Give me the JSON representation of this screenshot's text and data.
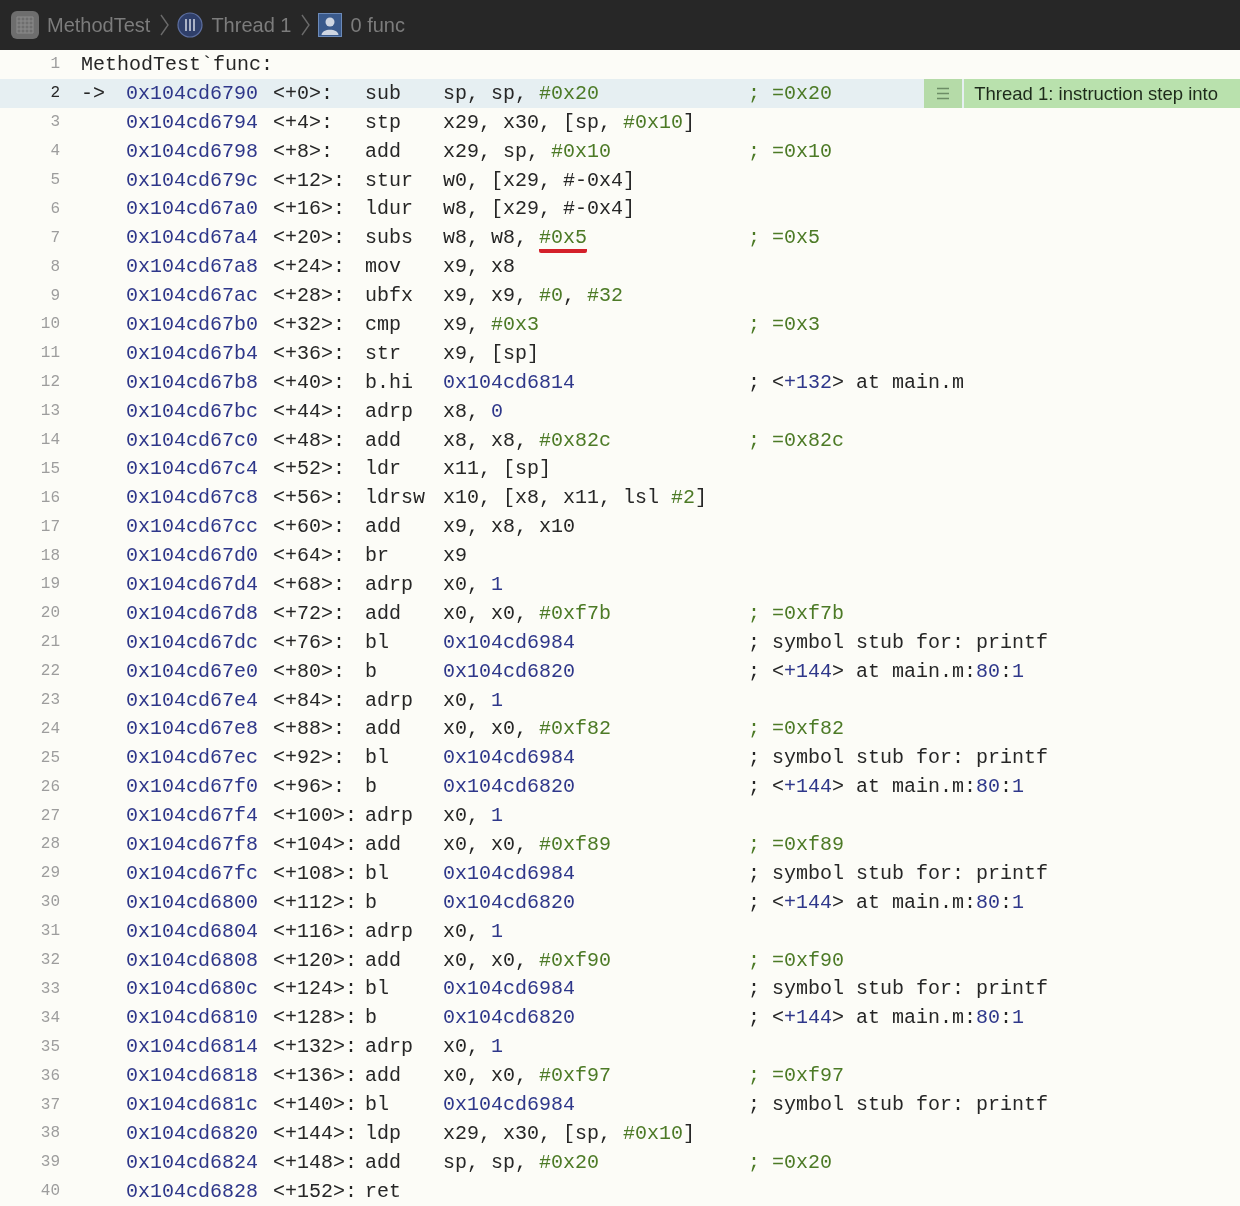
{
  "breadcrumbs": [
    {
      "kind": "app",
      "label": "MethodTest"
    },
    {
      "kind": "thread",
      "label": "Thread 1"
    },
    {
      "kind": "frame",
      "label": "0 func"
    }
  ],
  "lines": [
    {
      "number": "1",
      "kind": "label",
      "current": false,
      "label": "MethodTest`func:"
    },
    {
      "number": "2",
      "kind": "instruction",
      "current": true,
      "pointer": "->",
      "address": "0x104cd6790",
      "offset": "<+0>:",
      "mnemonic": "sub",
      "operands": [
        {
          "text": "sp, sp, ",
          "kind": "plain"
        },
        {
          "text": "#0x20",
          "kind": "imm"
        }
      ],
      "comment": [
        {
          "text": "; =0x20",
          "kind": "imm"
        }
      ],
      "annotation": "Thread 1: instruction step into"
    },
    {
      "number": "3",
      "kind": "instruction",
      "current": false,
      "address": "0x104cd6794",
      "offset": "<+4>:",
      "mnemonic": "stp",
      "operands": [
        {
          "text": "x29, x30, [sp, ",
          "kind": "plain"
        },
        {
          "text": "#0x10",
          "kind": "imm"
        },
        {
          "text": "]",
          "kind": "plain"
        }
      ]
    },
    {
      "number": "4",
      "kind": "instruction",
      "current": false,
      "address": "0x104cd6798",
      "offset": "<+8>:",
      "mnemonic": "add",
      "operands": [
        {
          "text": "x29, sp, ",
          "kind": "plain"
        },
        {
          "text": "#0x10",
          "kind": "imm"
        }
      ],
      "comment": [
        {
          "text": "; =0x10",
          "kind": "imm"
        }
      ]
    },
    {
      "number": "5",
      "kind": "instruction",
      "current": false,
      "address": "0x104cd679c",
      "offset": "<+12>:",
      "mnemonic": "stur",
      "operands": [
        {
          "text": "w0, [x29, #-0x4]",
          "kind": "plain"
        }
      ]
    },
    {
      "number": "6",
      "kind": "instruction",
      "current": false,
      "address": "0x104cd67a0",
      "offset": "<+16>:",
      "mnemonic": "ldur",
      "operands": [
        {
          "text": "w8, [x29, #-0x4]",
          "kind": "plain"
        }
      ]
    },
    {
      "number": "7",
      "kind": "instruction",
      "current": false,
      "address": "0x104cd67a4",
      "offset": "<+20>:",
      "mnemonic": "subs",
      "operands": [
        {
          "text": "w8, w8, ",
          "kind": "plain"
        },
        {
          "text": "#0x5",
          "kind": "imm",
          "underlined": true
        }
      ],
      "comment": [
        {
          "text": "; =0x5",
          "kind": "imm"
        }
      ]
    },
    {
      "number": "8",
      "kind": "instruction",
      "current": false,
      "address": "0x104cd67a8",
      "offset": "<+24>:",
      "mnemonic": "mov",
      "operands": [
        {
          "text": "x9, x8",
          "kind": "plain"
        }
      ]
    },
    {
      "number": "9",
      "kind": "instruction",
      "current": false,
      "address": "0x104cd67ac",
      "offset": "<+28>:",
      "mnemonic": "ubfx",
      "operands": [
        {
          "text": "x9, x9, ",
          "kind": "plain"
        },
        {
          "text": "#0",
          "kind": "imm"
        },
        {
          "text": ", ",
          "kind": "plain"
        },
        {
          "text": "#32",
          "kind": "imm"
        }
      ]
    },
    {
      "number": "10",
      "kind": "instruction",
      "current": false,
      "address": "0x104cd67b0",
      "offset": "<+32>:",
      "mnemonic": "cmp",
      "operands": [
        {
          "text": "x9, ",
          "kind": "plain"
        },
        {
          "text": "#0x3",
          "kind": "imm"
        }
      ],
      "comment": [
        {
          "text": "; =0x3",
          "kind": "imm"
        }
      ]
    },
    {
      "number": "11",
      "kind": "instruction",
      "current": false,
      "address": "0x104cd67b4",
      "offset": "<+36>:",
      "mnemonic": "str",
      "operands": [
        {
          "text": "x9, [sp]",
          "kind": "plain"
        }
      ]
    },
    {
      "number": "12",
      "kind": "instruction",
      "current": false,
      "address": "0x104cd67b8",
      "offset": "<+40>:",
      "mnemonic": "b.hi",
      "operands": [
        {
          "text": "0x104cd6814",
          "kind": "addr"
        }
      ],
      "comment": [
        {
          "text": "; <",
          "kind": "plain"
        },
        {
          "text": "+132",
          "kind": "addr"
        },
        {
          "text": "> at main.m",
          "kind": "plain"
        }
      ]
    },
    {
      "number": "13",
      "kind": "instruction",
      "current": false,
      "address": "0x104cd67bc",
      "offset": "<+44>:",
      "mnemonic": "adrp",
      "operands": [
        {
          "text": "x8, ",
          "kind": "plain"
        },
        {
          "text": "0",
          "kind": "addr"
        }
      ]
    },
    {
      "number": "14",
      "kind": "instruction",
      "current": false,
      "address": "0x104cd67c0",
      "offset": "<+48>:",
      "mnemonic": "add",
      "operands": [
        {
          "text": "x8, x8, ",
          "kind": "plain"
        },
        {
          "text": "#0x82c",
          "kind": "imm"
        }
      ],
      "comment": [
        {
          "text": "; =0x82c",
          "kind": "imm"
        }
      ]
    },
    {
      "number": "15",
      "kind": "instruction",
      "current": false,
      "address": "0x104cd67c4",
      "offset": "<+52>:",
      "mnemonic": "ldr",
      "operands": [
        {
          "text": "x11, [sp]",
          "kind": "plain"
        }
      ]
    },
    {
      "number": "16",
      "kind": "instruction",
      "current": false,
      "address": "0x104cd67c8",
      "offset": "<+56>:",
      "mnemonic": "ldrsw",
      "operands": [
        {
          "text": "x10, [x8, x11, lsl ",
          "kind": "plain"
        },
        {
          "text": "#2",
          "kind": "imm"
        },
        {
          "text": "]",
          "kind": "plain"
        }
      ]
    },
    {
      "number": "17",
      "kind": "instruction",
      "current": false,
      "address": "0x104cd67cc",
      "offset": "<+60>:",
      "mnemonic": "add",
      "operands": [
        {
          "text": "x9, x8, x10",
          "kind": "plain"
        }
      ]
    },
    {
      "number": "18",
      "kind": "instruction",
      "current": false,
      "address": "0x104cd67d0",
      "offset": "<+64>:",
      "mnemonic": "br",
      "operands": [
        {
          "text": "x9",
          "kind": "plain"
        }
      ]
    },
    {
      "number": "19",
      "kind": "instruction",
      "current": false,
      "address": "0x104cd67d4",
      "offset": "<+68>:",
      "mnemonic": "adrp",
      "operands": [
        {
          "text": "x0, ",
          "kind": "plain"
        },
        {
          "text": "1",
          "kind": "addr"
        }
      ]
    },
    {
      "number": "20",
      "kind": "instruction",
      "current": false,
      "address": "0x104cd67d8",
      "offset": "<+72>:",
      "mnemonic": "add",
      "operands": [
        {
          "text": "x0, x0, ",
          "kind": "plain"
        },
        {
          "text": "#0xf7b",
          "kind": "imm"
        }
      ],
      "comment": [
        {
          "text": "; =0xf7b",
          "kind": "imm"
        }
      ]
    },
    {
      "number": "21",
      "kind": "instruction",
      "current": false,
      "address": "0x104cd67dc",
      "offset": "<+76>:",
      "mnemonic": "bl",
      "operands": [
        {
          "text": "0x104cd6984",
          "kind": "addr"
        }
      ],
      "comment": [
        {
          "text": "; symbol stub for: printf",
          "kind": "plain"
        }
      ]
    },
    {
      "number": "22",
      "kind": "instruction",
      "current": false,
      "address": "0x104cd67e0",
      "offset": "<+80>:",
      "mnemonic": "b",
      "operands": [
        {
          "text": "0x104cd6820",
          "kind": "addr"
        }
      ],
      "comment": [
        {
          "text": "; <",
          "kind": "plain"
        },
        {
          "text": "+144",
          "kind": "addr"
        },
        {
          "text": "> at main.m:",
          "kind": "plain"
        },
        {
          "text": "80",
          "kind": "addr"
        },
        {
          "text": ":",
          "kind": "plain"
        },
        {
          "text": "1",
          "kind": "addr"
        }
      ]
    },
    {
      "number": "23",
      "kind": "instruction",
      "current": false,
      "address": "0x104cd67e4",
      "offset": "<+84>:",
      "mnemonic": "adrp",
      "operands": [
        {
          "text": "x0, ",
          "kind": "plain"
        },
        {
          "text": "1",
          "kind": "addr"
        }
      ]
    },
    {
      "number": "24",
      "kind": "instruction",
      "current": false,
      "address": "0x104cd67e8",
      "offset": "<+88>:",
      "mnemonic": "add",
      "operands": [
        {
          "text": "x0, x0, ",
          "kind": "plain"
        },
        {
          "text": "#0xf82",
          "kind": "imm"
        }
      ],
      "comment": [
        {
          "text": "; =0xf82",
          "kind": "imm"
        }
      ]
    },
    {
      "number": "25",
      "kind": "instruction",
      "current": false,
      "address": "0x104cd67ec",
      "offset": "<+92>:",
      "mnemonic": "bl",
      "operands": [
        {
          "text": "0x104cd6984",
          "kind": "addr"
        }
      ],
      "comment": [
        {
          "text": "; symbol stub for: printf",
          "kind": "plain"
        }
      ]
    },
    {
      "number": "26",
      "kind": "instruction",
      "current": false,
      "address": "0x104cd67f0",
      "offset": "<+96>:",
      "mnemonic": "b",
      "operands": [
        {
          "text": "0x104cd6820",
          "kind": "addr"
        }
      ],
      "comment": [
        {
          "text": "; <",
          "kind": "plain"
        },
        {
          "text": "+144",
          "kind": "addr"
        },
        {
          "text": "> at main.m:",
          "kind": "plain"
        },
        {
          "text": "80",
          "kind": "addr"
        },
        {
          "text": ":",
          "kind": "plain"
        },
        {
          "text": "1",
          "kind": "addr"
        }
      ]
    },
    {
      "number": "27",
      "kind": "instruction",
      "current": false,
      "address": "0x104cd67f4",
      "offset": "<+100>:",
      "mnemonic": "adrp",
      "operands": [
        {
          "text": "x0, ",
          "kind": "plain"
        },
        {
          "text": "1",
          "kind": "addr"
        }
      ]
    },
    {
      "number": "28",
      "kind": "instruction",
      "current": false,
      "address": "0x104cd67f8",
      "offset": "<+104>:",
      "mnemonic": "add",
      "operands": [
        {
          "text": "x0, x0, ",
          "kind": "plain"
        },
        {
          "text": "#0xf89",
          "kind": "imm"
        }
      ],
      "comment": [
        {
          "text": "; =0xf89",
          "kind": "imm"
        }
      ]
    },
    {
      "number": "29",
      "kind": "instruction",
      "current": false,
      "address": "0x104cd67fc",
      "offset": "<+108>:",
      "mnemonic": "bl",
      "operands": [
        {
          "text": "0x104cd6984",
          "kind": "addr"
        }
      ],
      "comment": [
        {
          "text": "; symbol stub for: printf",
          "kind": "plain"
        }
      ]
    },
    {
      "number": "30",
      "kind": "instruction",
      "current": false,
      "address": "0x104cd6800",
      "offset": "<+112>:",
      "mnemonic": "b",
      "operands": [
        {
          "text": "0x104cd6820",
          "kind": "addr"
        }
      ],
      "comment": [
        {
          "text": "; <",
          "kind": "plain"
        },
        {
          "text": "+144",
          "kind": "addr"
        },
        {
          "text": "> at main.m:",
          "kind": "plain"
        },
        {
          "text": "80",
          "kind": "addr"
        },
        {
          "text": ":",
          "kind": "plain"
        },
        {
          "text": "1",
          "kind": "addr"
        }
      ]
    },
    {
      "number": "31",
      "kind": "instruction",
      "current": false,
      "address": "0x104cd6804",
      "offset": "<+116>:",
      "mnemonic": "adrp",
      "operands": [
        {
          "text": "x0, ",
          "kind": "plain"
        },
        {
          "text": "1",
          "kind": "addr"
        }
      ]
    },
    {
      "number": "32",
      "kind": "instruction",
      "current": false,
      "address": "0x104cd6808",
      "offset": "<+120>:",
      "mnemonic": "add",
      "operands": [
        {
          "text": "x0, x0, ",
          "kind": "plain"
        },
        {
          "text": "#0xf90",
          "kind": "imm"
        }
      ],
      "comment": [
        {
          "text": "; =0xf90",
          "kind": "imm"
        }
      ]
    },
    {
      "number": "33",
      "kind": "instruction",
      "current": false,
      "address": "0x104cd680c",
      "offset": "<+124>:",
      "mnemonic": "bl",
      "operands": [
        {
          "text": "0x104cd6984",
          "kind": "addr"
        }
      ],
      "comment": [
        {
          "text": "; symbol stub for: printf",
          "kind": "plain"
        }
      ]
    },
    {
      "number": "34",
      "kind": "instruction",
      "current": false,
      "address": "0x104cd6810",
      "offset": "<+128>:",
      "mnemonic": "b",
      "operands": [
        {
          "text": "0x104cd6820",
          "kind": "addr"
        }
      ],
      "comment": [
        {
          "text": "; <",
          "kind": "plain"
        },
        {
          "text": "+144",
          "kind": "addr"
        },
        {
          "text": "> at main.m:",
          "kind": "plain"
        },
        {
          "text": "80",
          "kind": "addr"
        },
        {
          "text": ":",
          "kind": "plain"
        },
        {
          "text": "1",
          "kind": "addr"
        }
      ]
    },
    {
      "number": "35",
      "kind": "instruction",
      "current": false,
      "address": "0x104cd6814",
      "offset": "<+132>:",
      "mnemonic": "adrp",
      "operands": [
        {
          "text": "x0, ",
          "kind": "plain"
        },
        {
          "text": "1",
          "kind": "addr"
        }
      ]
    },
    {
      "number": "36",
      "kind": "instruction",
      "current": false,
      "address": "0x104cd6818",
      "offset": "<+136>:",
      "mnemonic": "add",
      "operands": [
        {
          "text": "x0, x0, ",
          "kind": "plain"
        },
        {
          "text": "#0xf97",
          "kind": "imm"
        }
      ],
      "comment": [
        {
          "text": "; =0xf97",
          "kind": "imm"
        }
      ]
    },
    {
      "number": "37",
      "kind": "instruction",
      "current": false,
      "address": "0x104cd681c",
      "offset": "<+140>:",
      "mnemonic": "bl",
      "operands": [
        {
          "text": "0x104cd6984",
          "kind": "addr"
        }
      ],
      "comment": [
        {
          "text": "; symbol stub for: printf",
          "kind": "plain"
        }
      ]
    },
    {
      "number": "38",
      "kind": "instruction",
      "current": false,
      "address": "0x104cd6820",
      "offset": "<+144>:",
      "mnemonic": "ldp",
      "operands": [
        {
          "text": "x29, x30, [sp, ",
          "kind": "plain"
        },
        {
          "text": "#0x10",
          "kind": "imm"
        },
        {
          "text": "]",
          "kind": "plain"
        }
      ]
    },
    {
      "number": "39",
      "kind": "instruction",
      "current": false,
      "address": "0x104cd6824",
      "offset": "<+148>:",
      "mnemonic": "add",
      "operands": [
        {
          "text": "sp, sp, ",
          "kind": "plain"
        },
        {
          "text": "#0x20",
          "kind": "imm"
        }
      ],
      "comment": [
        {
          "text": "; =0x20",
          "kind": "imm"
        }
      ]
    },
    {
      "number": "40",
      "kind": "instruction",
      "current": false,
      "address": "0x104cd6828",
      "offset": "<+152>:",
      "mnemonic": "ret"
    }
  ]
}
